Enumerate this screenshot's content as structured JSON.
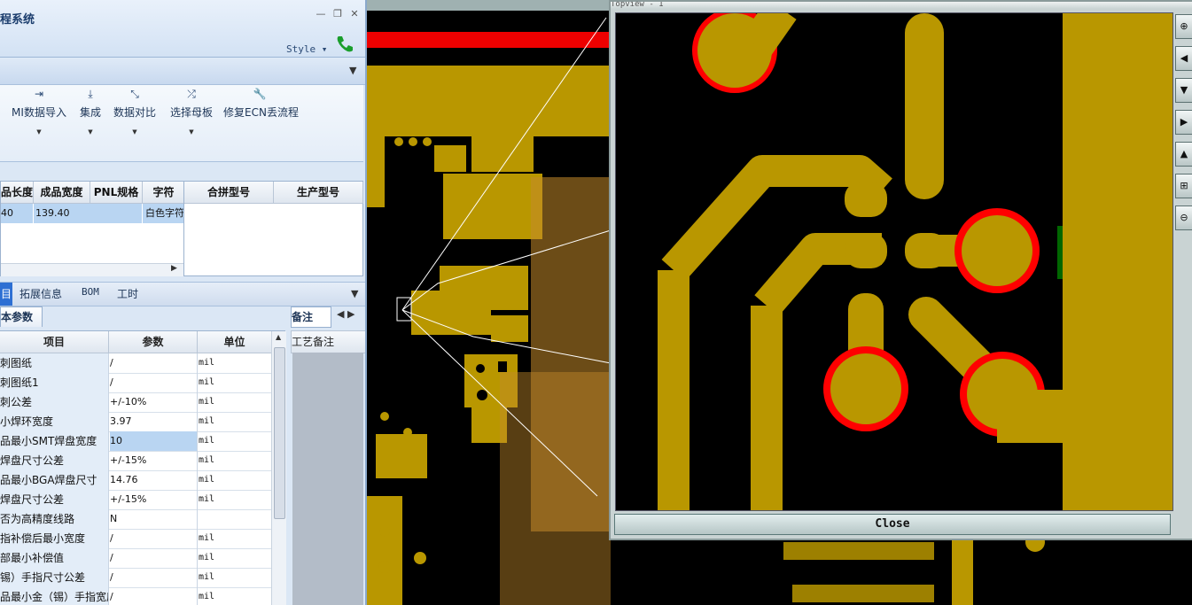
{
  "app": {
    "title": "程系统",
    "style_menu": "Style ▾",
    "ribbon_buttons": [
      {
        "label": "MI数据导入",
        "icon": "import-icon"
      },
      {
        "label": "集成",
        "icon": "download-icon"
      },
      {
        "label": "数据对比",
        "icon": "compare-icon"
      },
      {
        "label": "选择母板",
        "icon": "shuffle-icon"
      },
      {
        "label": "修复ECN丢流程",
        "icon": "wrench-icon"
      }
    ]
  },
  "grid1": {
    "headers": [
      "品长度",
      "成品宽度",
      "PNL规格",
      "字符"
    ],
    "row": [
      "40",
      "139.40",
      "",
      "白色字符"
    ]
  },
  "grid2": {
    "headers": [
      "合拼型号",
      "生产型号"
    ]
  },
  "tabs": {
    "active": "目",
    "items": [
      "拓展信息",
      "BOM",
      "工时"
    ]
  },
  "params": {
    "subtab": "本参数",
    "headers": [
      "项目",
      "参数",
      "单位"
    ],
    "rows": [
      {
        "item": "刺图纸",
        "value": "/",
        "unit": "mil"
      },
      {
        "item": "刺图纸1",
        "value": "/",
        "unit": "mil"
      },
      {
        "item": "刺公差",
        "value": "+/-10%",
        "unit": "mil"
      },
      {
        "item": "小焊环宽度",
        "value": "3.97",
        "unit": "mil"
      },
      {
        "item": "品最小SMT焊盘宽度",
        "value": "10",
        "unit": "mil"
      },
      {
        "item": "焊盘尺寸公差",
        "value": "+/-15%",
        "unit": "mil"
      },
      {
        "item": "品最小BGA焊盘尺寸",
        "value": "14.76",
        "unit": "mil"
      },
      {
        "item": "焊盘尺寸公差",
        "value": "+/-15%",
        "unit": "mil"
      },
      {
        "item": "否为高精度线路",
        "value": "N",
        "unit": ""
      },
      {
        "item": "指补偿后最小宽度",
        "value": "/",
        "unit": "mil"
      },
      {
        "item": "部最小补偿值",
        "value": "/",
        "unit": "mil"
      },
      {
        "item": "锡）手指尺寸公差",
        "value": "/",
        "unit": "mil"
      },
      {
        "item": "品最小金（锡）手指宽度",
        "value": "/",
        "unit": "mil"
      }
    ]
  },
  "notes": {
    "tab": "备注",
    "header": "工艺备注"
  },
  "popup": {
    "title": "Topview - 1",
    "close_label": "Close"
  },
  "colors": {
    "pcb_copper": "#b99700",
    "pad_outline": "#ff0000",
    "board_red": "#ee0000",
    "window_blue": "#dbe7f5"
  }
}
